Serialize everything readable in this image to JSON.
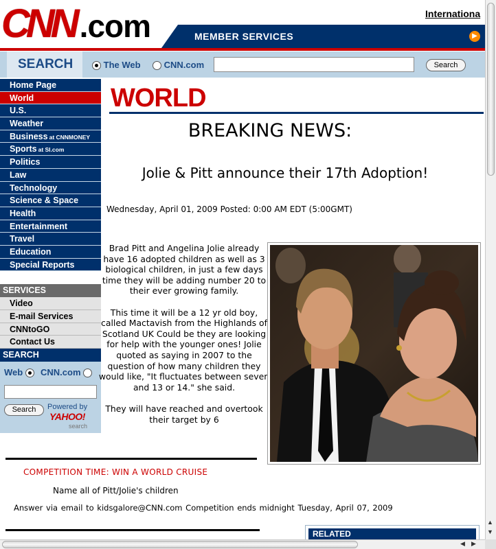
{
  "header": {
    "logo_cnn": "CNN",
    "logo_dotcom": ".com",
    "international_link": "Internationa",
    "member_services": "MEMBER SERVICES",
    "member_arrow_icon": "orange-arrow-icon",
    "accent_color": "#cc0000",
    "brand_navy": "#00306b"
  },
  "search": {
    "title": "SEARCH",
    "option_web": "The Web",
    "option_cnn": "CNN.com",
    "selected": "The Web",
    "input_value": "",
    "button_label": "Search"
  },
  "nav": {
    "items": [
      {
        "label": "Home Page",
        "suffix": ""
      },
      {
        "label": "World",
        "suffix": "",
        "active": true
      },
      {
        "label": "U.S.",
        "suffix": ""
      },
      {
        "label": "Weather",
        "suffix": ""
      },
      {
        "label": "Business",
        "suffix": "at CNNMONEY"
      },
      {
        "label": "Sports",
        "suffix": "at SI.com"
      },
      {
        "label": "Politics",
        "suffix": ""
      },
      {
        "label": "Law",
        "suffix": ""
      },
      {
        "label": "Technology",
        "suffix": ""
      },
      {
        "label": "Science & Space",
        "suffix": ""
      },
      {
        "label": "Health",
        "suffix": ""
      },
      {
        "label": "Entertainment",
        "suffix": ""
      },
      {
        "label": "Travel",
        "suffix": ""
      },
      {
        "label": "Education",
        "suffix": ""
      },
      {
        "label": "Special Reports",
        "suffix": ""
      }
    ],
    "services_heading": "SERVICES",
    "services": [
      "Video",
      "E-mail Services",
      "CNNtoGO",
      "Contact Us"
    ],
    "search_heading": "SEARCH",
    "search_option_web": "Web",
    "search_option_cnn": "CNN.com",
    "search_selected": "Web",
    "search_input_value": "",
    "search_button": "Search",
    "powered_by": "Powered by",
    "yahoo": "YAHOO!",
    "yahoo_sub": "search"
  },
  "main": {
    "section_title": "WORLD",
    "headline": "BREAKING NEWS:",
    "subheadline": "Jolie & Pitt announce their 17th Adoption!",
    "dateline": "Wednesday, April 01, 2009 Posted: 0:00 AM EDT (5:00GMT)",
    "paragraphs": [
      "Brad Pitt and Angelina Jolie already have 16 adopted children as well as 3 biological children, in just a few days time they will be adding number 20 to their ever growing  family.",
      "This time it will be a 12 yr old boy, called Mactavish from the Highlands of Scotland UK Could be they are looking for help with the younger ones! Jolie quoted as saying in 2007 to the question of how many children they would like, \"It fluctuates between seven and 13 or 14.\" she said.",
      "They will have reached and overtook their target by 6"
    ],
    "photo_icon": "couple-photo"
  },
  "competition": {
    "title": "COMPETITION TIME:  WIN A WORLD CRUISE",
    "question": "Name  all  of  Pitt/Jolie's  children",
    "answer_line": "Answer via email to  kidsgalore@CNN.com   Competition ends midnight  Tuesday,  April  07,  2009"
  },
  "related": {
    "heading": "RELATED"
  }
}
